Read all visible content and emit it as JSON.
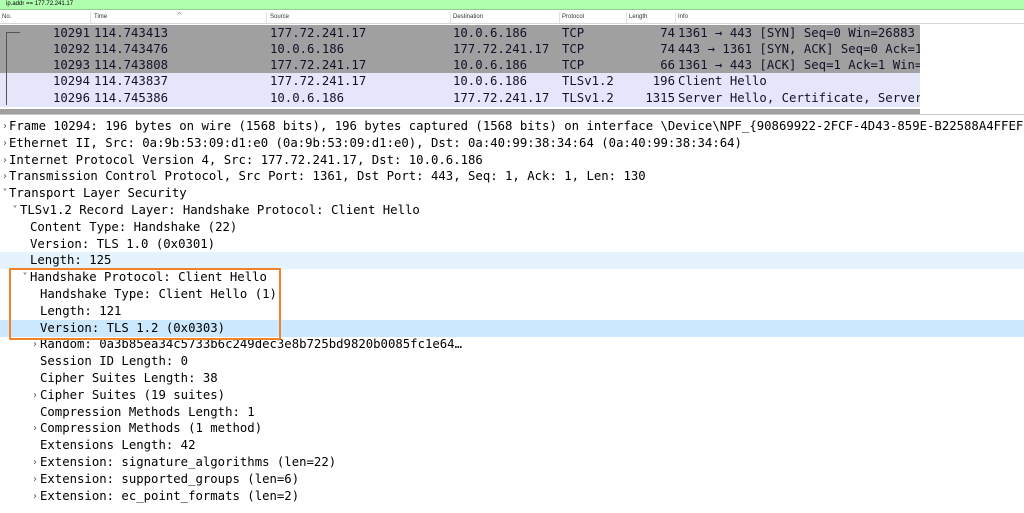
{
  "filter": {
    "text": "ip.addr == 177.72.241.17"
  },
  "packet_list": {
    "columns": [
      "No.",
      "Time",
      "Source",
      "Destination",
      "Protocol",
      "Length",
      "Info"
    ],
    "rows": [
      {
        "no": "10291",
        "time": "114.743413",
        "src": "177.72.241.17",
        "dst": "10.0.6.186",
        "proto": "TCP",
        "len": "74",
        "info": "1361 → 443 [SYN] Seq=0 Win=26883 …",
        "style": "tcp"
      },
      {
        "no": "10292",
        "time": "114.743476",
        "src": "10.0.6.186",
        "dst": "177.72.241.17",
        "proto": "TCP",
        "len": "74",
        "info": "443 → 1361 [SYN, ACK] Seq=0 Ack=1…",
        "style": "tcp"
      },
      {
        "no": "10293",
        "time": "114.743808",
        "src": "177.72.241.17",
        "dst": "10.0.6.186",
        "proto": "TCP",
        "len": "66",
        "info": "1361 → 443 [ACK] Seq=1 Ack=1 Win=…",
        "style": "tcp"
      },
      {
        "no": "10294",
        "time": "114.743837",
        "src": "177.72.241.17",
        "dst": "10.0.6.186",
        "proto": "TLSv1.2",
        "len": "196",
        "info": "Client Hello",
        "style": "tls"
      },
      {
        "no": "10296",
        "time": "114.745386",
        "src": "10.0.6.186",
        "dst": "177.72.241.17",
        "proto": "TLSv1.2",
        "len": "1315",
        "info": "Server Hello, Certificate, Server…",
        "style": "tls"
      }
    ]
  },
  "details": [
    {
      "arrow": "›",
      "indent": 0,
      "text": "Frame 10294: 196 bytes on wire (1568 bits), 196 bytes captured (1568 bits) on interface \\Device\\NPF_{90869922-2FCF-4D43-859E-B22588A4FFEF}, id 0",
      "hl": ""
    },
    {
      "arrow": "›",
      "indent": 0,
      "text": "Ethernet II, Src: 0a:9b:53:09:d1:e0 (0a:9b:53:09:d1:e0), Dst: 0a:40:99:38:34:64 (0a:40:99:38:34:64)",
      "hl": ""
    },
    {
      "arrow": "›",
      "indent": 0,
      "text": "Internet Protocol Version 4, Src: 177.72.241.17, Dst: 10.0.6.186",
      "hl": ""
    },
    {
      "arrow": "›",
      "indent": 0,
      "text": "Transmission Control Protocol, Src Port: 1361, Dst Port: 443, Seq: 1, Ack: 1, Len: 130",
      "hl": ""
    },
    {
      "arrow": "˅",
      "indent": 0,
      "text": "Transport Layer Security",
      "hl": ""
    },
    {
      "arrow": "˅",
      "indent": 1,
      "text": "TLSv1.2 Record Layer: Handshake Protocol: Client Hello",
      "hl": ""
    },
    {
      "arrow": "",
      "indent": 2,
      "text": "Content Type: Handshake (22)",
      "hl": ""
    },
    {
      "arrow": "",
      "indent": 2,
      "text": "Version: TLS 1.0 (0x0301)",
      "hl": ""
    },
    {
      "arrow": "",
      "indent": 2,
      "text": "Length: 125",
      "hl": "light"
    },
    {
      "arrow": "˅",
      "indent": 2,
      "text": "Handshake Protocol: Client Hello",
      "hl": ""
    },
    {
      "arrow": "",
      "indent": 3,
      "text": "Handshake Type: Client Hello (1)",
      "hl": ""
    },
    {
      "arrow": "",
      "indent": 3,
      "text": "Length: 121",
      "hl": ""
    },
    {
      "arrow": "",
      "indent": 3,
      "text": "Version: TLS 1.2 (0x0303)",
      "hl": "sel"
    },
    {
      "arrow": "›",
      "indent": 3,
      "text": "Random: 0a3b85ea34c5733b6c249dec3e8b725bd9820b0085fc1e64…",
      "hl": ""
    },
    {
      "arrow": "",
      "indent": 3,
      "text": "Session ID Length: 0",
      "hl": ""
    },
    {
      "arrow": "",
      "indent": 3,
      "text": "Cipher Suites Length: 38",
      "hl": ""
    },
    {
      "arrow": "›",
      "indent": 3,
      "text": "Cipher Suites (19 suites)",
      "hl": ""
    },
    {
      "arrow": "",
      "indent": 3,
      "text": "Compression Methods Length: 1",
      "hl": ""
    },
    {
      "arrow": "›",
      "indent": 3,
      "text": "Compression Methods (1 method)",
      "hl": ""
    },
    {
      "arrow": "",
      "indent": 3,
      "text": "Extensions Length: 42",
      "hl": ""
    },
    {
      "arrow": "›",
      "indent": 3,
      "text": "Extension: signature_algorithms (len=22)",
      "hl": ""
    },
    {
      "arrow": "›",
      "indent": 3,
      "text": "Extension: supported_groups (len=6)",
      "hl": ""
    },
    {
      "arrow": "›",
      "indent": 3,
      "text": "Extension: ec_point_formats (len=2)",
      "hl": ""
    }
  ],
  "colors": {
    "tcp_row": "#a0a0a0",
    "tls_row": "#e6e6fa",
    "selected": "#cce8ff",
    "annotation_box": "#f0832a",
    "filter_bg": "#afffaf"
  }
}
